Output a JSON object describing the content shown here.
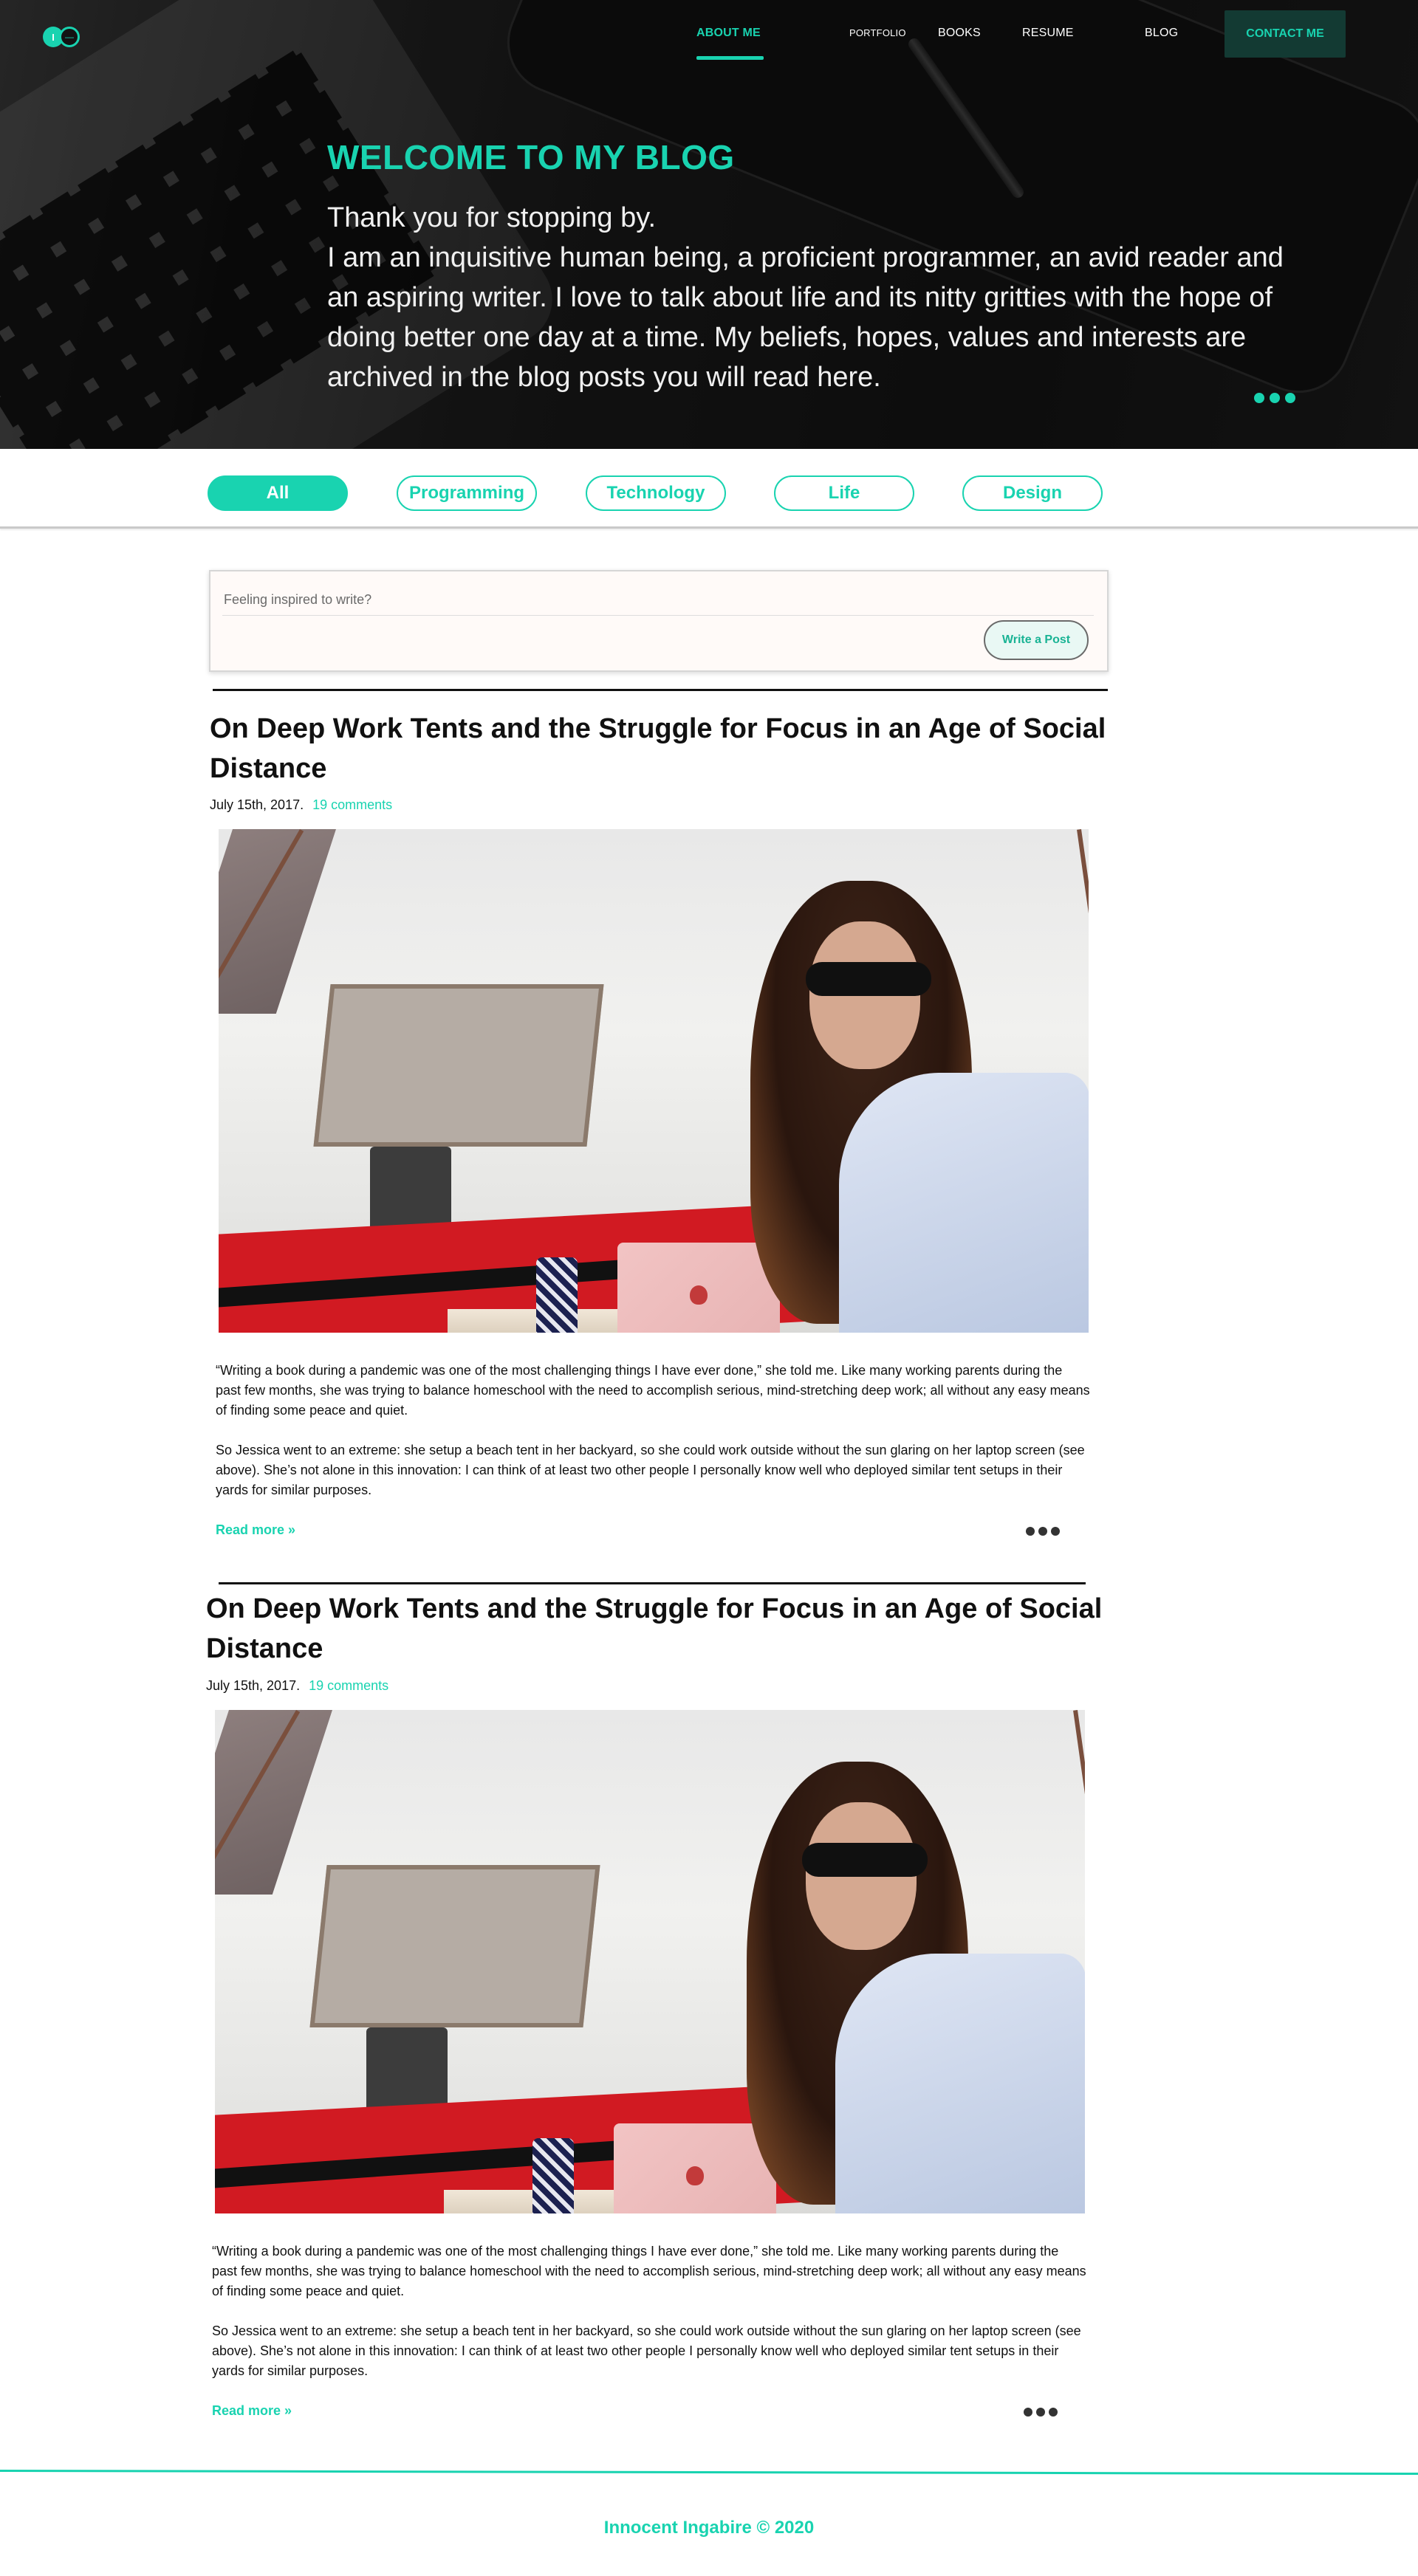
{
  "logo": {
    "left_letter": "I",
    "right_letter": "—"
  },
  "nav": {
    "about": "ABOUT ME",
    "portfolio": "PORTFOLIO",
    "books": "BOOKS",
    "resume": "RESUME",
    "blog": "BLOG",
    "contact": "CONTACT ME"
  },
  "hero": {
    "title": "WELCOME TO MY BLOG",
    "line1": "Thank you for stopping by.",
    "line2": "I am an inquisitive human being, a proficient programmer, an avid reader and an aspiring writer. I love to talk about life and its nitty gritties with the hope of doing better one day at a time. My beliefs, hopes, values and interests are archived in the blog posts you will read here."
  },
  "filters": [
    {
      "label": "All",
      "active": true
    },
    {
      "label": "Programming",
      "active": false
    },
    {
      "label": "Technology",
      "active": false
    },
    {
      "label": "Life",
      "active": false
    },
    {
      "label": "Design",
      "active": false
    }
  ],
  "composer": {
    "placeholder": "Feeling inspired to write?",
    "button": "Write a Post"
  },
  "posts": [
    {
      "title": "On Deep Work Tents and the Struggle for Focus in an Age of Social Distance",
      "date": "July 15th, 2017.",
      "comments": "19 comments",
      "p1": "“Writing a book during a pandemic was one of the most challenging things I have ever done,” she told me. Like many working parents during the past few months, she was trying to balance homeschool with the need to accomplish serious, mind-stretching deep work; all without any easy means of finding some peace and quiet.",
      "p2": "So Jessica went to an extreme: she setup a beach tent in her backyard, so she could work outside without the sun glaring on her laptop screen (see above). She’s not alone in this innovation: I can think of at least two other people I personally know well who deployed similar tent setups in their yards for similar purposes.",
      "read_more": "Read more »"
    },
    {
      "title": "On Deep Work Tents and the Struggle for Focus in an Age of Social Distance",
      "date": "July 15th, 2017.",
      "comments": "19 comments",
      "p1": "“Writing a book during a pandemic was one of the most challenging things I have ever done,” she told me. Like many working parents during the past few months, she was trying to balance homeschool with the need to accomplish serious, mind-stretching deep work; all without any easy means of finding some peace and quiet.",
      "p2": "So Jessica went to an extreme: she setup a beach tent in her backyard, so she could work outside without the sun glaring on her laptop screen (see above). She’s not alone in this innovation: I can think of at least two other people I personally know well who deployed similar tent setups in their yards for similar purposes.",
      "read_more": "Read more »"
    }
  ],
  "footer": {
    "text": "Innocent Ingabire  © 2020"
  },
  "colors": {
    "accent": "#19d3b0",
    "dark": "#141414",
    "text": "#111111"
  }
}
